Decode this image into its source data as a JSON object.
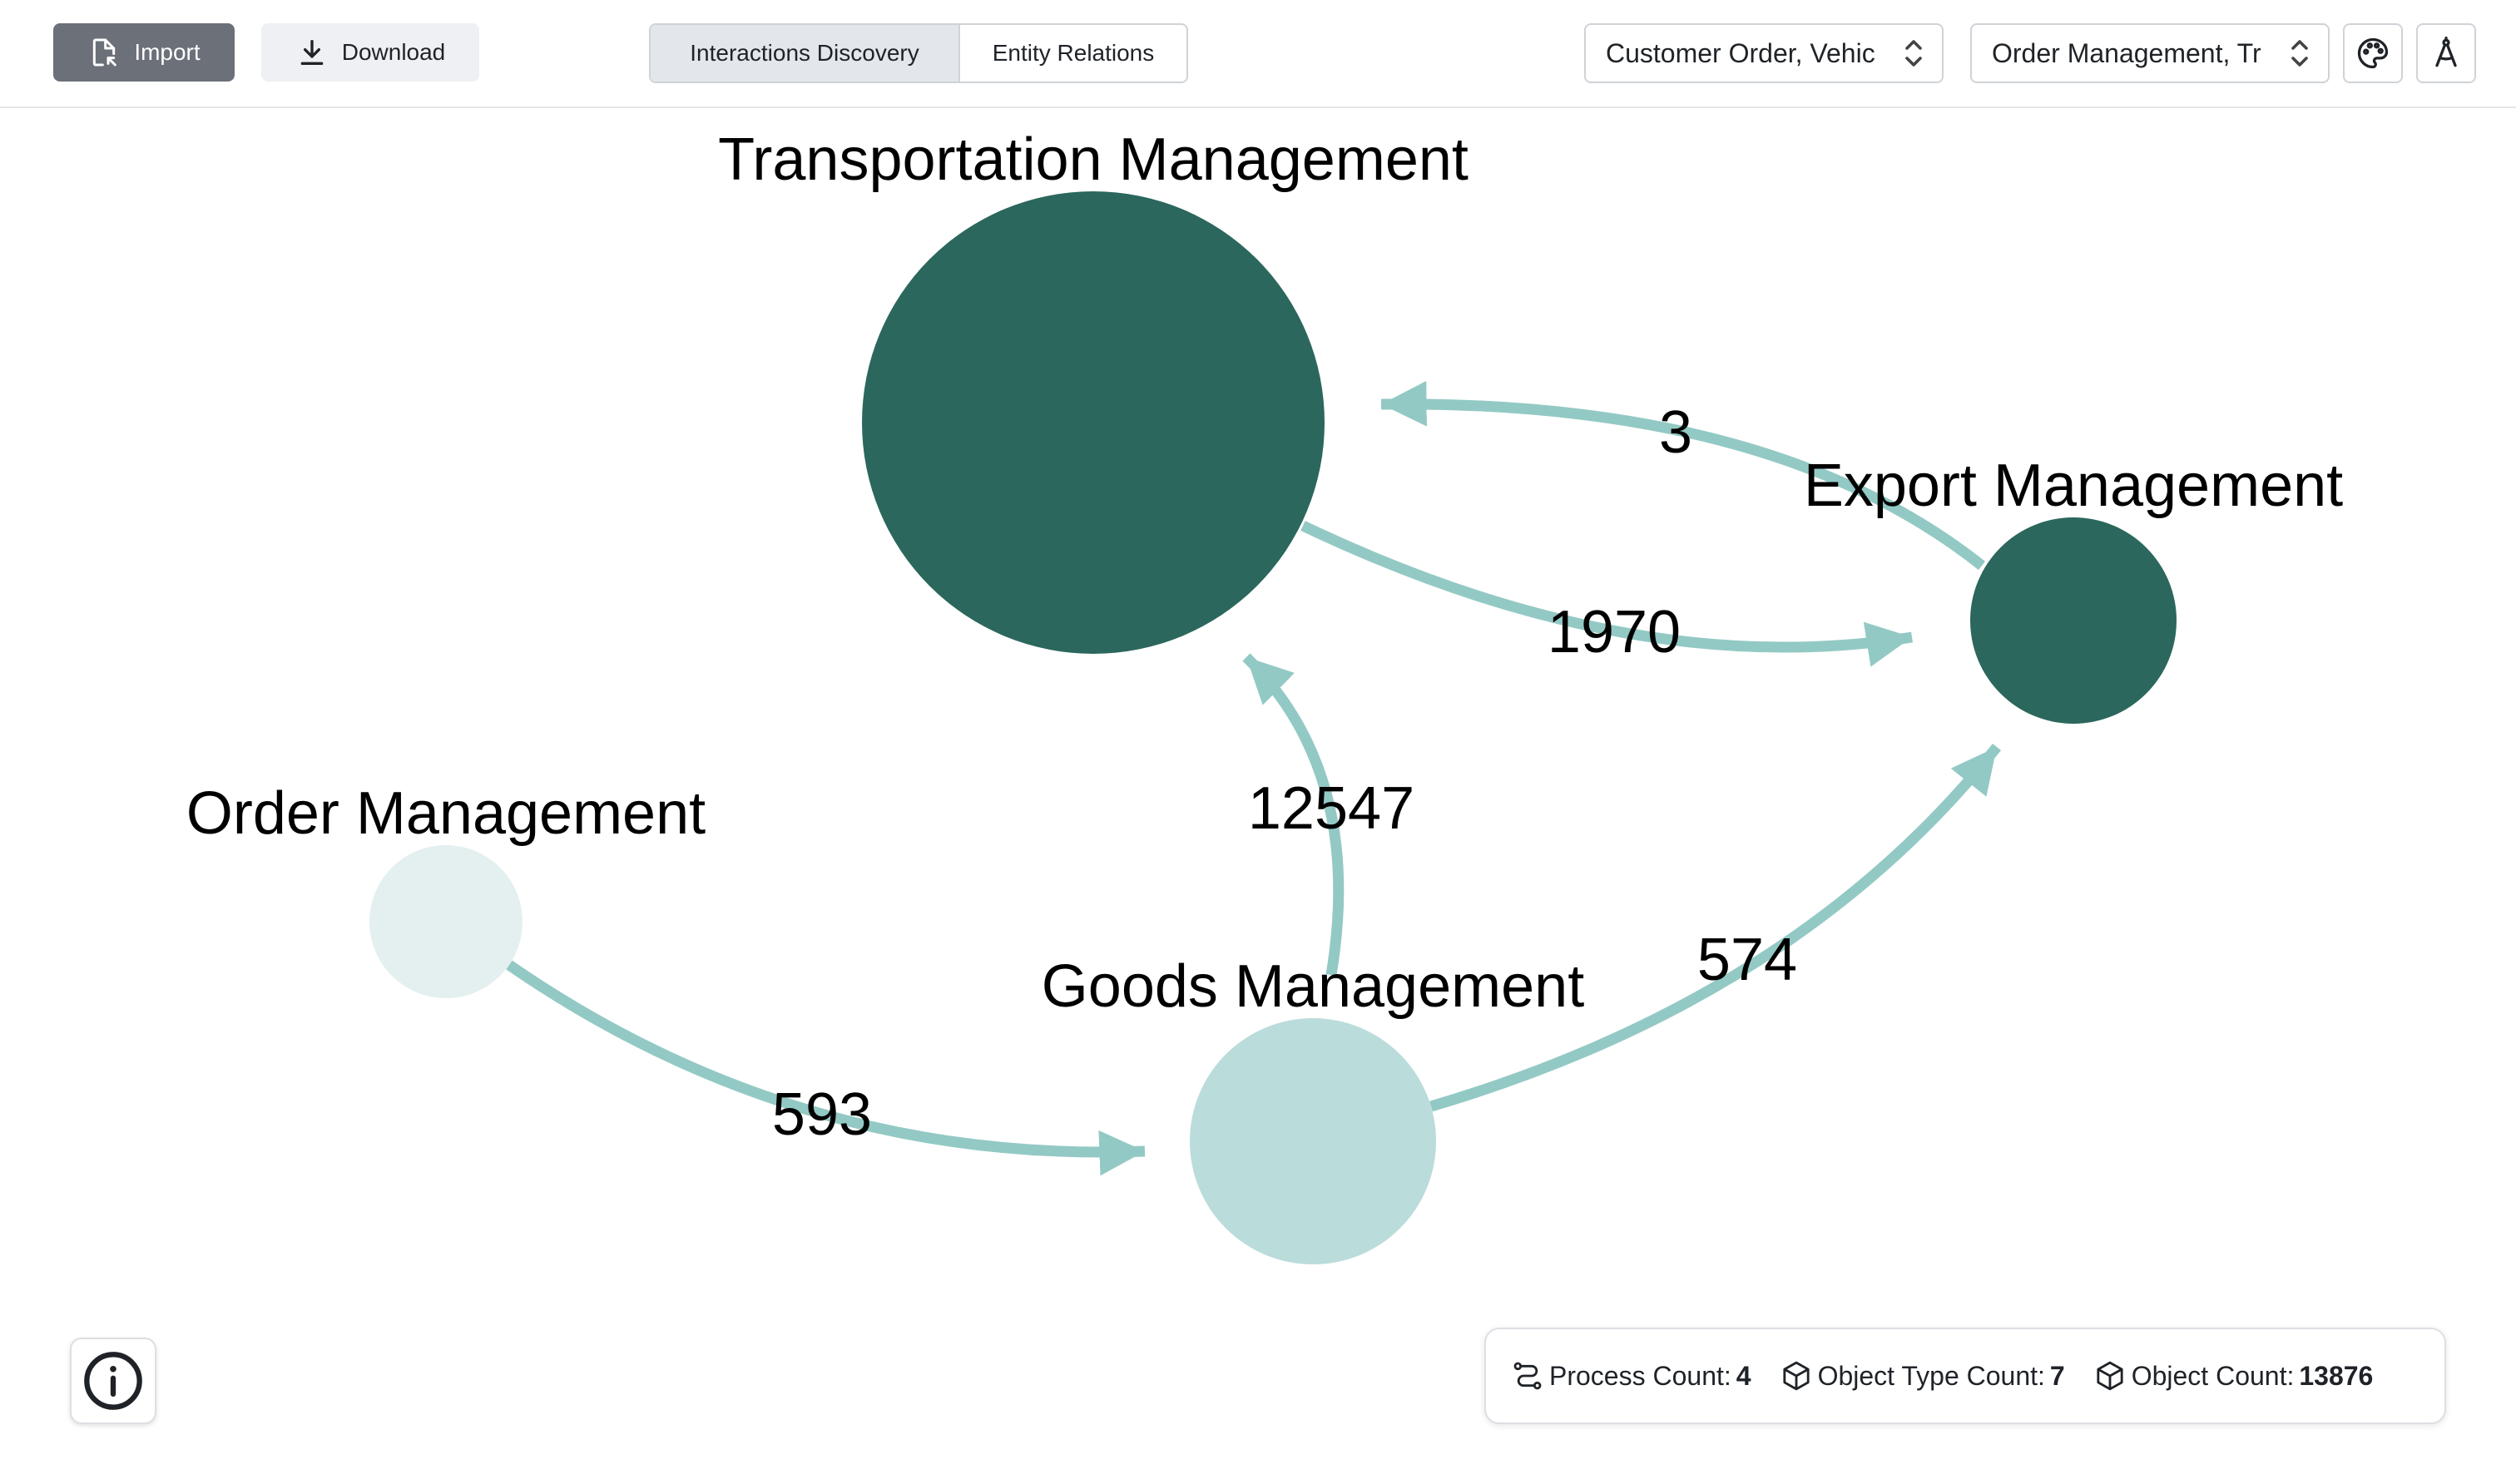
{
  "toolbar": {
    "import_label": "Import",
    "download_label": "Download",
    "tabs": [
      {
        "label": "Interactions Discovery",
        "active": true
      },
      {
        "label": "Entity Relations",
        "active": false
      }
    ],
    "object_type_filter": "Customer Order, Vehic",
    "process_filter": "Order Management, Tr",
    "palette_icon": "palette-icon",
    "compass_icon": "compass-icon"
  },
  "graph": {
    "nodes": [
      {
        "id": "transportation",
        "label": "Transportation Management",
        "color": "#2b675c"
      },
      {
        "id": "export",
        "label": "Export Management",
        "color": "#2b675c"
      },
      {
        "id": "order",
        "label": "Order Management",
        "color": "#e3f0ef"
      },
      {
        "id": "goods",
        "label": "Goods Management",
        "color": "#badcda"
      }
    ],
    "edges": [
      {
        "from": "export",
        "to": "transportation",
        "label": "3"
      },
      {
        "from": "transportation",
        "to": "export",
        "label": "1970"
      },
      {
        "from": "goods",
        "to": "transportation",
        "label": "12547"
      },
      {
        "from": "goods",
        "to": "export",
        "label": "574"
      },
      {
        "from": "order",
        "to": "goods",
        "label": "593"
      }
    ],
    "edge_color": "#93c9c4"
  },
  "stats": {
    "process_label": "Process Count:",
    "process_value": "4",
    "object_type_label": "Object Type Count:",
    "object_type_value": "7",
    "object_label": "Object Count:",
    "object_value": "13876"
  }
}
